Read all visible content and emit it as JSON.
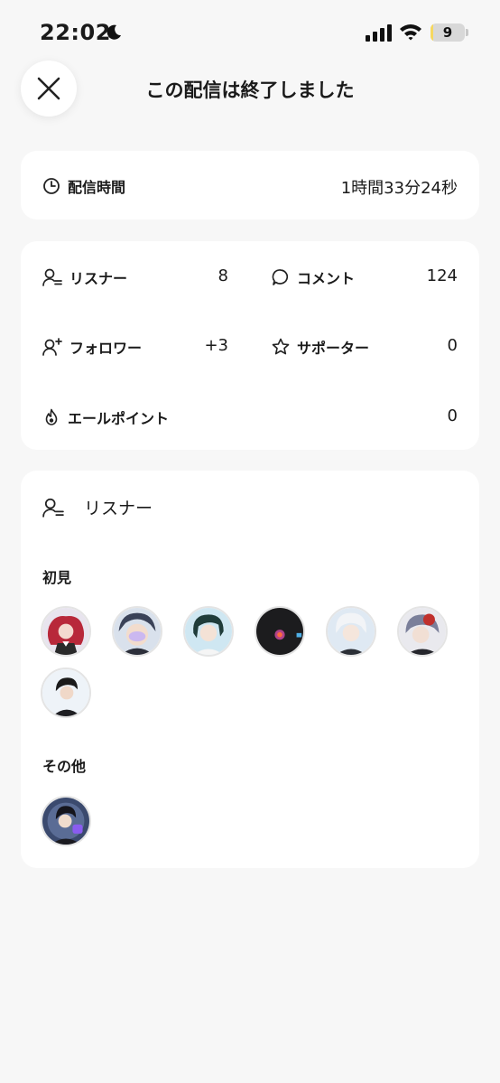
{
  "status_bar": {
    "time": "22:02",
    "battery": "9",
    "battery_level": 0.09
  },
  "header": {
    "title": "この配信は終了しました"
  },
  "duration": {
    "label": "配信時間",
    "value": "1時間33分24秒"
  },
  "stats": {
    "listeners_label": "リスナー",
    "listeners_value": "8",
    "comments_label": "コメント",
    "comments_value": "124",
    "followers_label": "フォロワー",
    "followers_value": "+3",
    "supporters_label": "サポーター",
    "supporters_value": "0",
    "yell_label": "エールポイント",
    "yell_value": "0"
  },
  "listeners": {
    "title": "リスナー",
    "first_time_label": "初見",
    "others_label": "その他",
    "first_time_count": 7,
    "others_count": 1
  },
  "colors": {
    "background": "#f7f7f7",
    "card": "#ffffff",
    "battery": "#f6d860"
  }
}
